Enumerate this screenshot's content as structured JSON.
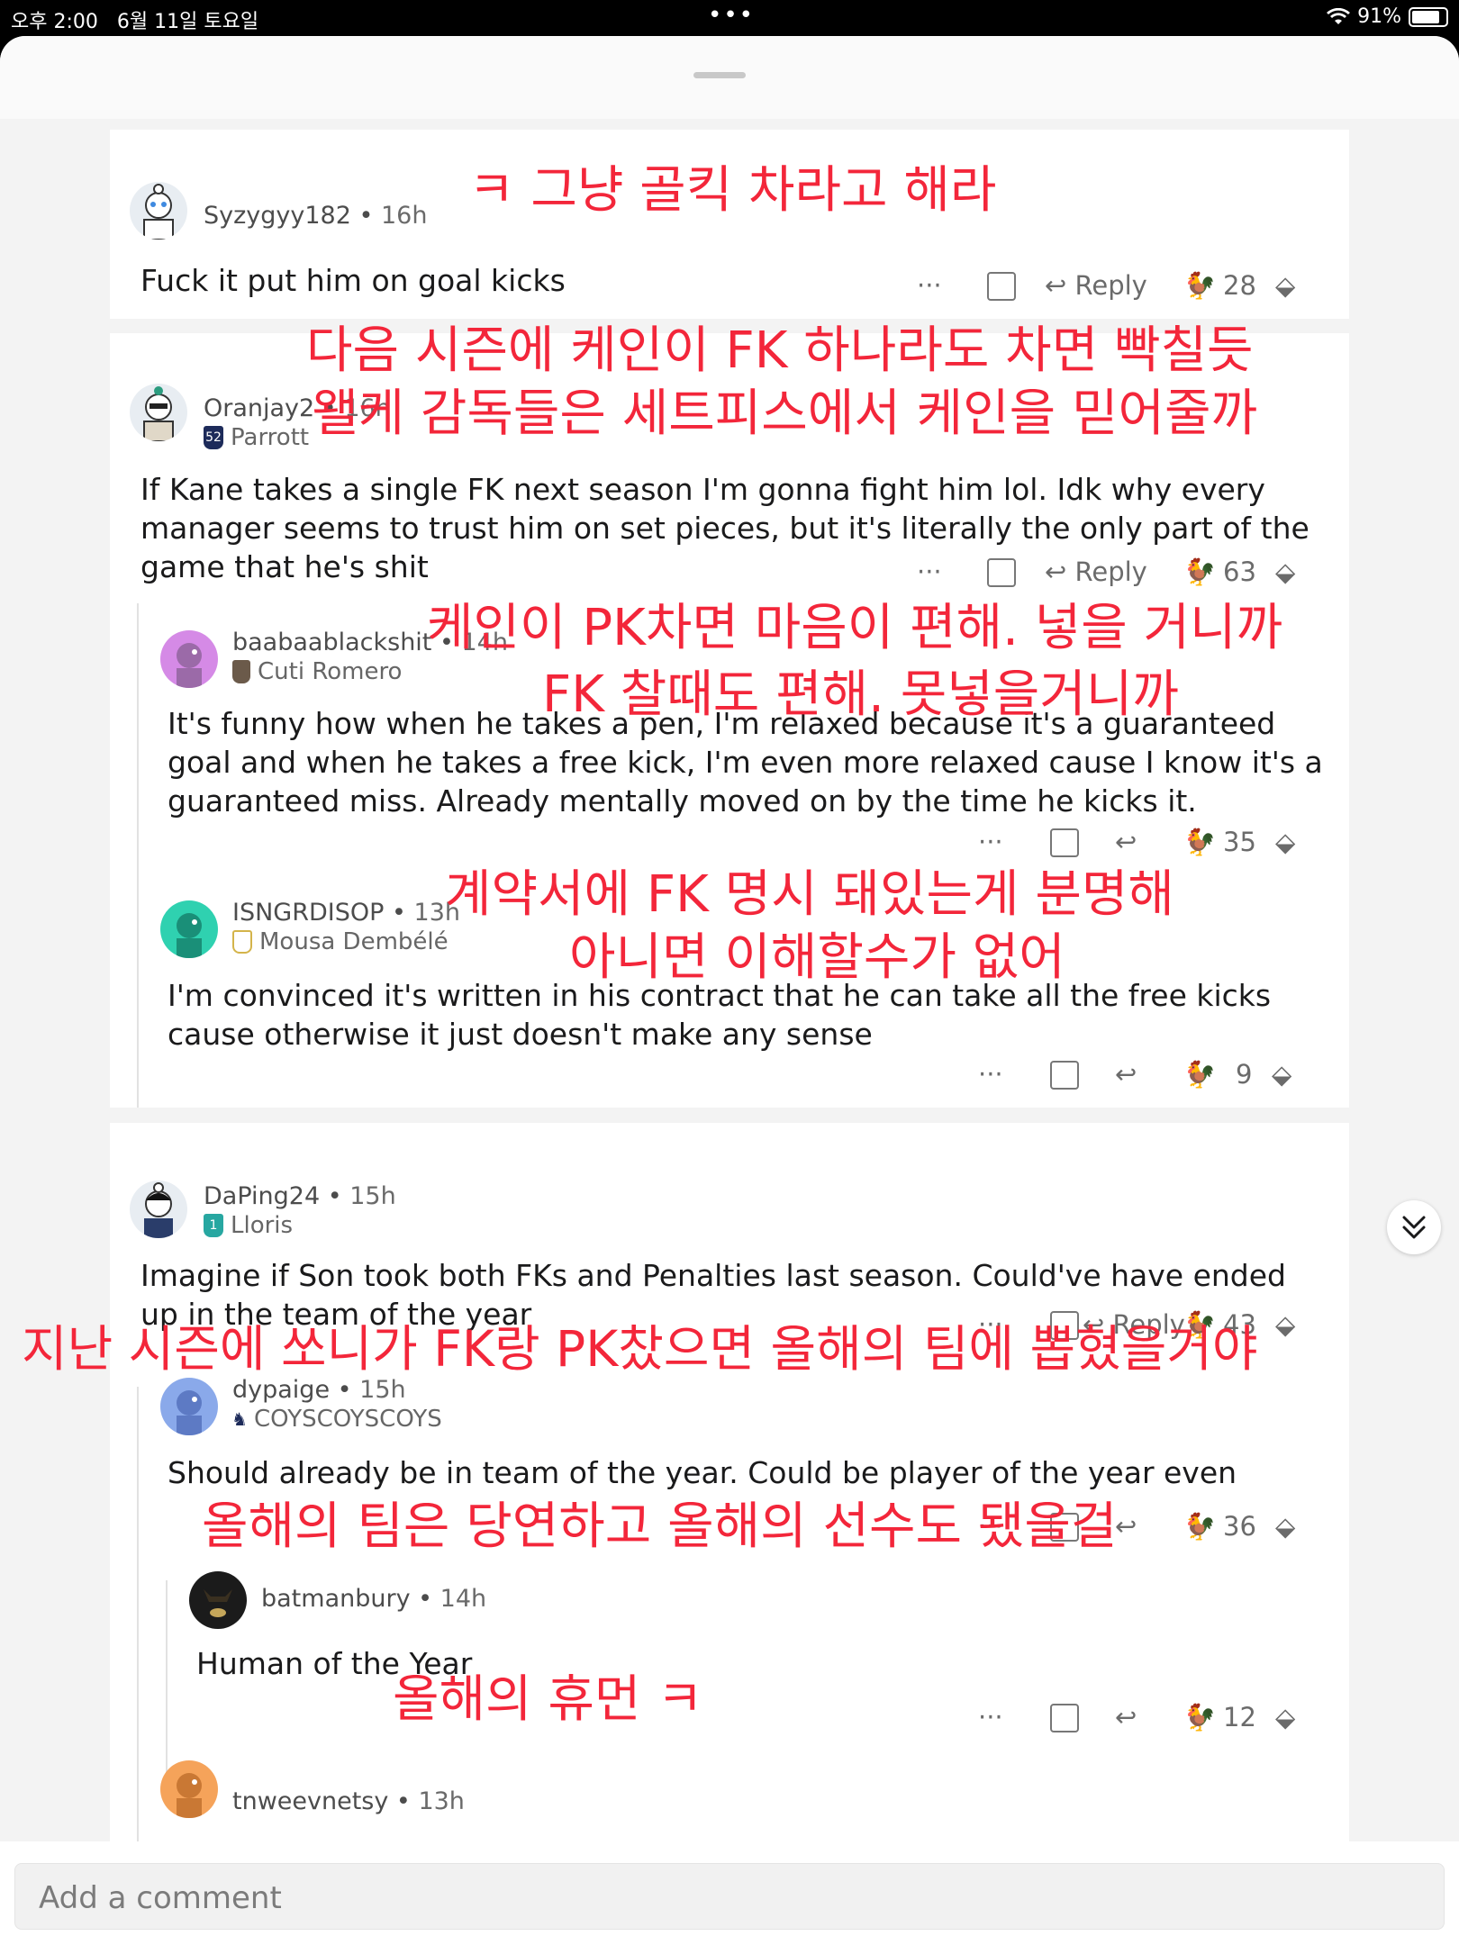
{
  "status": {
    "time": "오후 2:00",
    "date": "6월 11일 토요일",
    "dots": "•••",
    "battery": "91%"
  },
  "actions": {
    "more": "···",
    "reply": "Reply"
  },
  "comments": [
    {
      "user": "Syzygyy182",
      "time": "16h",
      "flair": "",
      "body": "Fuck it put him on goal kicks",
      "votes": "28"
    },
    {
      "user": "Oranjay2",
      "time": "16h",
      "flair": "Parrott",
      "body": "If Kane takes a single FK next season I'm gonna fight him lol. Idk why every manager seems to trust him on set pieces, but it's literally the only part of the game that he's shit",
      "votes": "63"
    },
    {
      "user": "baabaablackshit",
      "time": "14h",
      "flair": "Cuti Romero",
      "body": "It's funny how when he takes a pen, I'm relaxed because it's a guaranteed goal and when he takes a free kick, I'm even more relaxed cause I know it's a guaranteed miss. Already mentally moved on by the time he kicks it.",
      "votes": "35"
    },
    {
      "user": "ISNGRDISOP",
      "time": "13h",
      "flair": "Mousa Dembélé",
      "body": "I'm convinced it's written in his contract that he can take all the free kicks cause otherwise it just doesn't make any sense",
      "votes": "9"
    },
    {
      "user": "DaPing24",
      "time": "15h",
      "flair": "Lloris",
      "body": "Imagine if Son took both FKs and Penalties last season. Could've have ended up in the team of the year",
      "votes": "43"
    },
    {
      "user": "dypaige",
      "time": "15h",
      "flair": "COYSCOYSCOYS",
      "body": "Should already be in team of the year. Could be player of the year even",
      "votes": "36"
    },
    {
      "user": "batmanbury",
      "time": "14h",
      "flair": "",
      "body": "Human of the Year",
      "votes": "12"
    },
    {
      "user": "tnweevnetsy",
      "time": "13h",
      "flair": "",
      "body": "",
      "votes": ""
    }
  ],
  "flair_badges": {
    "parrott": "52",
    "lloris": "1"
  },
  "overlays": {
    "o1": "ㅋ 그냥 골킥 차라고 해라",
    "o2a": "다음 시즌에 케인이 FK 하나라도 차면 빡칠듯",
    "o2b": "왤케 감독들은 세트피스에서 케인을 믿어줄까",
    "o3a": "케인이 PK차면 마음이 편해. 넣을 거니까",
    "o3b": "FK 찰때도 편해. 못넣을거니까",
    "o4a": "계약서에 FK 명시 돼있는게 분명해",
    "o4b": "아니면 이해할수가 없어",
    "o5": "지난 시즌에 쏘니가 FK랑 PK찼으면 올해의 팀에 뽑혔을거야",
    "o6": "올해의 팀은 당연하고 올해의 선수도 됐을걸",
    "o7": "올해의 휴먼 ㅋ"
  },
  "composer": {
    "placeholder": "Add a comment"
  },
  "colors": {
    "overlay_red": "#f3263a",
    "text": "#1a1a1b",
    "meta": "#6a6a6a"
  }
}
